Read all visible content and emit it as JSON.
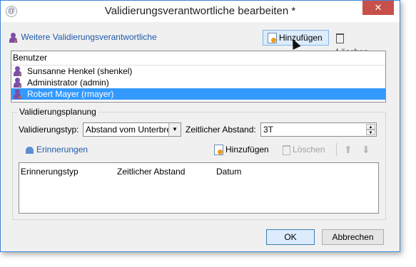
{
  "window": {
    "title": "Validierungsverantwortliche bearbeiten *",
    "close_glyph": "✕"
  },
  "toolbar": {
    "link_label": "Weitere Validierungsverantwortliche",
    "add_label": "Hinzufügen",
    "delete_label": "Löschen"
  },
  "users": {
    "header": "Benutzer",
    "rows": [
      "Sunsanne Henkel (shenkel)",
      "Administrator (admin)",
      "Robert Mayer (rmayer)"
    ],
    "selected_index": 2
  },
  "planning": {
    "legend": "Validierungsplanung",
    "type_label": "Validierungstyp:",
    "type_value": "Abstand vom Unterbre",
    "interval_label": "Zeitlicher Abstand:",
    "interval_value": "3T",
    "reminders_label": "Erinnerungen",
    "add_label": "Hinzufügen",
    "delete_label": "Löschen",
    "columns": [
      "Erinnerungstyp",
      "Zeitlicher Abstand",
      "Datum"
    ]
  },
  "footer": {
    "ok_label": "OK",
    "cancel_label": "Abbrechen"
  },
  "colors": {
    "accent": "#3399ff",
    "close": "#c7504a",
    "link": "#1f5aa8"
  }
}
